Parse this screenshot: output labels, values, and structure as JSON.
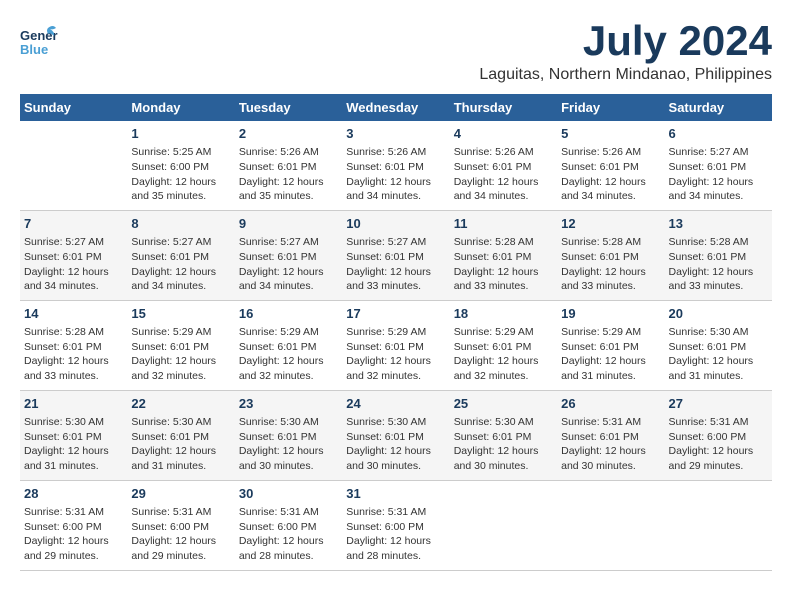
{
  "logo": {
    "line1": "General",
    "line2": "Blue"
  },
  "title": {
    "month_year": "July 2024",
    "location": "Laguitas, Northern Mindanao, Philippines"
  },
  "header_days": [
    "Sunday",
    "Monday",
    "Tuesday",
    "Wednesday",
    "Thursday",
    "Friday",
    "Saturday"
  ],
  "weeks": [
    {
      "days": [
        {
          "num": "",
          "info": ""
        },
        {
          "num": "1",
          "info": "Sunrise: 5:25 AM\nSunset: 6:00 PM\nDaylight: 12 hours\nand 35 minutes."
        },
        {
          "num": "2",
          "info": "Sunrise: 5:26 AM\nSunset: 6:01 PM\nDaylight: 12 hours\nand 35 minutes."
        },
        {
          "num": "3",
          "info": "Sunrise: 5:26 AM\nSunset: 6:01 PM\nDaylight: 12 hours\nand 34 minutes."
        },
        {
          "num": "4",
          "info": "Sunrise: 5:26 AM\nSunset: 6:01 PM\nDaylight: 12 hours\nand 34 minutes."
        },
        {
          "num": "5",
          "info": "Sunrise: 5:26 AM\nSunset: 6:01 PM\nDaylight: 12 hours\nand 34 minutes."
        },
        {
          "num": "6",
          "info": "Sunrise: 5:27 AM\nSunset: 6:01 PM\nDaylight: 12 hours\nand 34 minutes."
        }
      ]
    },
    {
      "days": [
        {
          "num": "7",
          "info": "Sunrise: 5:27 AM\nSunset: 6:01 PM\nDaylight: 12 hours\nand 34 minutes."
        },
        {
          "num": "8",
          "info": "Sunrise: 5:27 AM\nSunset: 6:01 PM\nDaylight: 12 hours\nand 34 minutes."
        },
        {
          "num": "9",
          "info": "Sunrise: 5:27 AM\nSunset: 6:01 PM\nDaylight: 12 hours\nand 34 minutes."
        },
        {
          "num": "10",
          "info": "Sunrise: 5:27 AM\nSunset: 6:01 PM\nDaylight: 12 hours\nand 33 minutes."
        },
        {
          "num": "11",
          "info": "Sunrise: 5:28 AM\nSunset: 6:01 PM\nDaylight: 12 hours\nand 33 minutes."
        },
        {
          "num": "12",
          "info": "Sunrise: 5:28 AM\nSunset: 6:01 PM\nDaylight: 12 hours\nand 33 minutes."
        },
        {
          "num": "13",
          "info": "Sunrise: 5:28 AM\nSunset: 6:01 PM\nDaylight: 12 hours\nand 33 minutes."
        }
      ]
    },
    {
      "days": [
        {
          "num": "14",
          "info": "Sunrise: 5:28 AM\nSunset: 6:01 PM\nDaylight: 12 hours\nand 33 minutes."
        },
        {
          "num": "15",
          "info": "Sunrise: 5:29 AM\nSunset: 6:01 PM\nDaylight: 12 hours\nand 32 minutes."
        },
        {
          "num": "16",
          "info": "Sunrise: 5:29 AM\nSunset: 6:01 PM\nDaylight: 12 hours\nand 32 minutes."
        },
        {
          "num": "17",
          "info": "Sunrise: 5:29 AM\nSunset: 6:01 PM\nDaylight: 12 hours\nand 32 minutes."
        },
        {
          "num": "18",
          "info": "Sunrise: 5:29 AM\nSunset: 6:01 PM\nDaylight: 12 hours\nand 32 minutes."
        },
        {
          "num": "19",
          "info": "Sunrise: 5:29 AM\nSunset: 6:01 PM\nDaylight: 12 hours\nand 31 minutes."
        },
        {
          "num": "20",
          "info": "Sunrise: 5:30 AM\nSunset: 6:01 PM\nDaylight: 12 hours\nand 31 minutes."
        }
      ]
    },
    {
      "days": [
        {
          "num": "21",
          "info": "Sunrise: 5:30 AM\nSunset: 6:01 PM\nDaylight: 12 hours\nand 31 minutes."
        },
        {
          "num": "22",
          "info": "Sunrise: 5:30 AM\nSunset: 6:01 PM\nDaylight: 12 hours\nand 31 minutes."
        },
        {
          "num": "23",
          "info": "Sunrise: 5:30 AM\nSunset: 6:01 PM\nDaylight: 12 hours\nand 30 minutes."
        },
        {
          "num": "24",
          "info": "Sunrise: 5:30 AM\nSunset: 6:01 PM\nDaylight: 12 hours\nand 30 minutes."
        },
        {
          "num": "25",
          "info": "Sunrise: 5:30 AM\nSunset: 6:01 PM\nDaylight: 12 hours\nand 30 minutes."
        },
        {
          "num": "26",
          "info": "Sunrise: 5:31 AM\nSunset: 6:01 PM\nDaylight: 12 hours\nand 30 minutes."
        },
        {
          "num": "27",
          "info": "Sunrise: 5:31 AM\nSunset: 6:00 PM\nDaylight: 12 hours\nand 29 minutes."
        }
      ]
    },
    {
      "days": [
        {
          "num": "28",
          "info": "Sunrise: 5:31 AM\nSunset: 6:00 PM\nDaylight: 12 hours\nand 29 minutes."
        },
        {
          "num": "29",
          "info": "Sunrise: 5:31 AM\nSunset: 6:00 PM\nDaylight: 12 hours\nand 29 minutes."
        },
        {
          "num": "30",
          "info": "Sunrise: 5:31 AM\nSunset: 6:00 PM\nDaylight: 12 hours\nand 28 minutes."
        },
        {
          "num": "31",
          "info": "Sunrise: 5:31 AM\nSunset: 6:00 PM\nDaylight: 12 hours\nand 28 minutes."
        },
        {
          "num": "",
          "info": ""
        },
        {
          "num": "",
          "info": ""
        },
        {
          "num": "",
          "info": ""
        }
      ]
    }
  ]
}
